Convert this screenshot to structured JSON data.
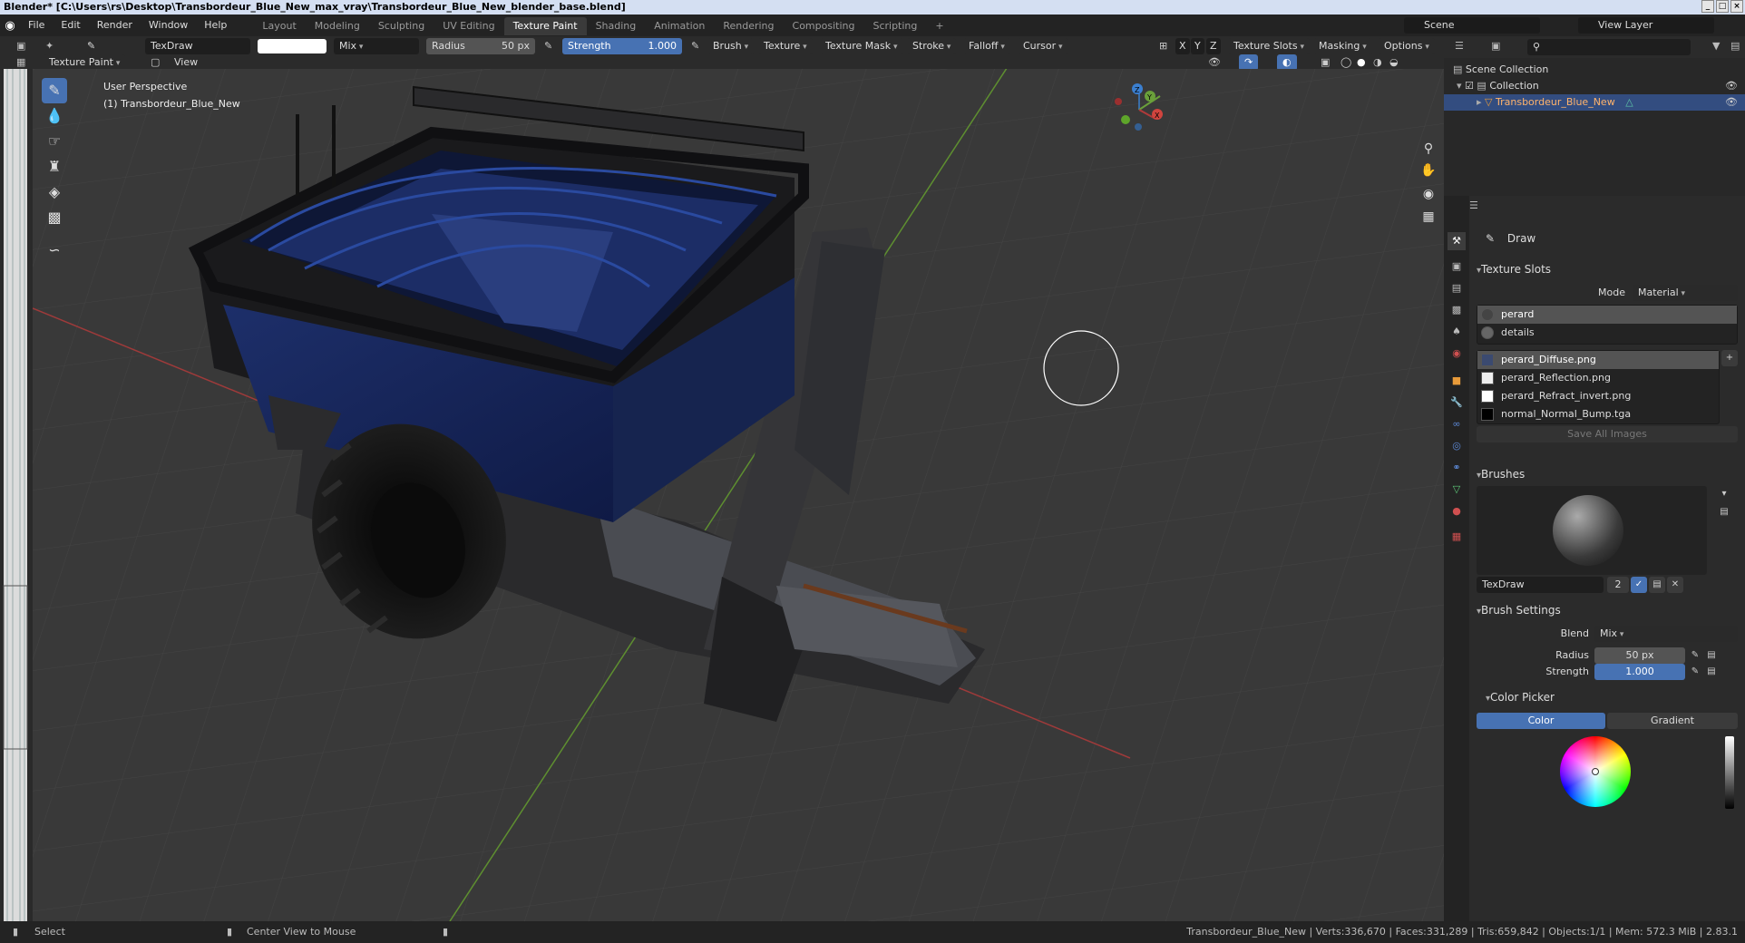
{
  "window": {
    "title": "Blender* [C:\\Users\\rs\\Desktop\\Transbordeur_Blue_New_max_vray\\Transbordeur_Blue_New_blender_base.blend]",
    "controls": [
      "_",
      "□",
      "×"
    ]
  },
  "menu": {
    "items": [
      "File",
      "Edit",
      "Render",
      "Window",
      "Help"
    ]
  },
  "workspaces": {
    "tabs": [
      "Layout",
      "Modeling",
      "Sculpting",
      "UV Editing",
      "Texture Paint",
      "Shading",
      "Animation",
      "Rendering",
      "Compositing",
      "Scripting"
    ],
    "active": "Texture Paint",
    "add": "+"
  },
  "scene": {
    "scene_name": "Scene",
    "view_layer": "View Layer"
  },
  "tool_header": {
    "brush_name": "TexDraw",
    "blend": "Mix",
    "radius_label": "Radius",
    "radius_value": "50 px",
    "strength_label": "Strength",
    "strength_value": "1.000",
    "menus": [
      "Brush",
      "Texture",
      "Texture Mask",
      "Stroke",
      "Falloff",
      "Cursor"
    ],
    "axes": [
      "X",
      "Y",
      "Z"
    ],
    "right_menus": [
      "Texture Slots",
      "Masking",
      "Options"
    ]
  },
  "header2": {
    "mode": "Texture Paint",
    "view_menu": "View"
  },
  "viewport": {
    "perspective": "User Perspective",
    "object_label": "(1) Transbordeur_Blue_New",
    "gizmo_axes": [
      "X",
      "Y",
      "Z"
    ],
    "grid_color": "#404040",
    "x_axis_color": "#b03a3a",
    "y_axis_color": "#6aa03a"
  },
  "tools": {
    "items": [
      "draw-tool",
      "soften-tool",
      "smear-tool",
      "clone-tool",
      "fill-tool",
      "mask-tool",
      "annotate-tool"
    ]
  },
  "outliner": {
    "root": "Scene Collection",
    "collection": "Collection",
    "object": "Transbordeur_Blue_New"
  },
  "properties": {
    "tool_name": "Draw",
    "texture_slots": {
      "header": "Texture Slots",
      "mode_label": "Mode",
      "mode_value": "Material",
      "materials": [
        "perard",
        "details"
      ],
      "images": [
        "perard_Diffuse.png",
        "perard_Reflection.png",
        "perard_Refract_invert.png",
        "normal_Normal_Bump.tga"
      ],
      "save_all": "Save All Images"
    },
    "brushes": {
      "header": "Brushes",
      "brush_name": "TexDraw",
      "users": "2"
    },
    "brush_settings": {
      "header": "Brush Settings",
      "blend_label": "Blend",
      "blend_value": "Mix",
      "radius_label": "Radius",
      "radius_value": "50 px",
      "strength_label": "Strength",
      "strength_value": "1.000"
    },
    "color_picker": {
      "header": "Color Picker",
      "tab_color": "Color",
      "tab_gradient": "Gradient"
    }
  },
  "statusbar": {
    "select": "Select",
    "center_view": "Center View to Mouse",
    "stats": "Transbordeur_Blue_New | Verts:336,670 | Faces:331,289 | Tris:659,842 | Objects:1/1 | Mem: 572.3 MiB | 2.83.1"
  }
}
